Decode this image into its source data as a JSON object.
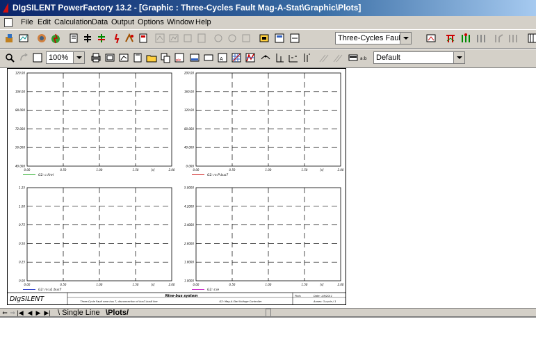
{
  "window": {
    "title": "DIgSILENT PowerFactory 13.2 - [Graphic : Three-Cycles Fault Mag-A-Stat\\Graphic\\Plots]"
  },
  "menu": {
    "items": [
      "File",
      "Edit",
      "Calculation",
      "Data",
      "Output",
      "Options",
      "Window",
      "Help"
    ]
  },
  "toolbar1": {
    "graphic_select_value": "Three-Cycles Fault Mag-A-"
  },
  "toolbar2": {
    "zoom_value": "100%",
    "style_select_value": "Default"
  },
  "plots": [
    {
      "y_ticks": [
        "120.00",
        "104.00",
        "88.000",
        "72.000",
        "56.000",
        "40.000"
      ],
      "x_ticks": [
        "0.00",
        "0.50",
        "1.00",
        "1.50",
        "[s]",
        "2.00"
      ],
      "legend": "G2: c:firel",
      "legend_color": "#22aa22"
    },
    {
      "y_ticks": [
        "200.00",
        "160.00",
        "120.00",
        "80.000",
        "40.000",
        "0.000"
      ],
      "x_ticks": [
        "0.00",
        "0.50",
        "1.00",
        "1.50",
        "[s]",
        "2.00"
      ],
      "legend": "G2: m:P:bus7",
      "legend_color": "#cc1111"
    },
    {
      "y_ticks": [
        "1.25",
        "1.00",
        "0.75",
        "0.50",
        "0.25",
        "0.00"
      ],
      "x_ticks": [
        "0.00",
        "0.50",
        "1.00",
        "1.50",
        "[s]",
        "2.00"
      ],
      "legend": "G2: m:u1:bus7",
      "legend_color": "#3344cc"
    },
    {
      "y_ticks": [
        "5.0000",
        "4.2000",
        "3.4000",
        "2.6000",
        "1.8000",
        "1.0000"
      ],
      "x_ticks": [
        "0.00",
        "0.50",
        "1.00",
        "1.50",
        "[s]",
        "2.00"
      ],
      "legend": "G2: s:ie",
      "legend_color": "#cc33cc"
    }
  ],
  "titleblock": {
    "logo": "DIgSILENT",
    "project": "Nine-bus system",
    "description": "Three-Cycle Fault near bus 7, disconnection of bus7-bus8 line",
    "subtitle": "G2: Mag-A-Stat Voltage Controller",
    "plots_label": "Plots",
    "date": "Date: 1/8/2011",
    "annex": "Annex: 3-cycle / 1"
  },
  "tabs": {
    "single_line": "Single Line",
    "plots": "Plots"
  }
}
